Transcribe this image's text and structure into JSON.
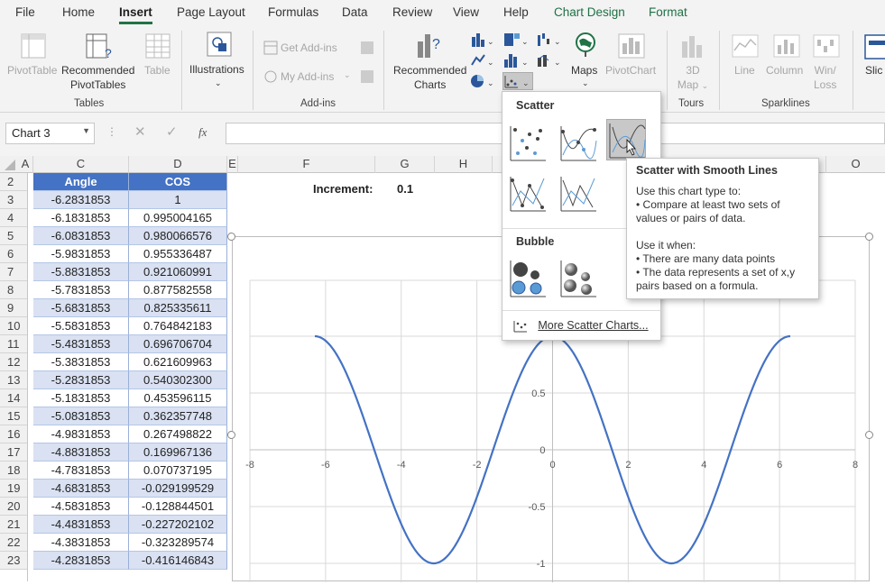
{
  "menu": {
    "tabs": [
      "File",
      "Home",
      "Insert",
      "Page Layout",
      "Formulas",
      "Data",
      "Review",
      "View",
      "Help",
      "Chart Design",
      "Format"
    ]
  },
  "ribbon": {
    "pivot_table": "PivotTable",
    "recommended_pivot_1": "Recommended",
    "recommended_pivot_2": "PivotTables",
    "table": "Table",
    "illustrations": "Illustrations",
    "get_addins": "Get Add-ins",
    "my_addins": "My Add-ins",
    "rec_charts_1": "Recommended",
    "rec_charts_2": "Charts",
    "maps": "Maps",
    "pivot_chart": "PivotChart",
    "map3d_1": "3D",
    "map3d_2": "Map",
    "line": "Line",
    "column": "Column",
    "winloss_1": "Win/",
    "winloss_2": "Loss",
    "slicer": "Slic",
    "groups": {
      "tables": "Tables",
      "addins": "Add-ins",
      "tours": "Tours",
      "sparklines": "Sparklines"
    }
  },
  "formula_bar": {
    "name_box": "Chart 3",
    "fx": "fx",
    "value": ""
  },
  "grid": {
    "columns": [
      "A",
      "C",
      "D",
      "E",
      "F",
      "G",
      "H",
      "O"
    ],
    "increment_label": "Increment:",
    "increment_value": "0.1",
    "headers": [
      "Angle",
      "COS"
    ],
    "rows": [
      {
        "r": "2",
        "angle": "",
        "cos": ""
      },
      {
        "r": "3",
        "angle": "-6.2831853",
        "cos": "1"
      },
      {
        "r": "4",
        "angle": "-6.1831853",
        "cos": "0.995004165"
      },
      {
        "r": "5",
        "angle": "-6.0831853",
        "cos": "0.980066576"
      },
      {
        "r": "6",
        "angle": "-5.9831853",
        "cos": "0.955336487"
      },
      {
        "r": "7",
        "angle": "-5.8831853",
        "cos": "0.921060991"
      },
      {
        "r": "8",
        "angle": "-5.7831853",
        "cos": "0.877582558"
      },
      {
        "r": "9",
        "angle": "-5.6831853",
        "cos": "0.825335611"
      },
      {
        "r": "10",
        "angle": "-5.5831853",
        "cos": "0.764842183"
      },
      {
        "r": "11",
        "angle": "-5.4831853",
        "cos": "0.696706704"
      },
      {
        "r": "12",
        "angle": "-5.3831853",
        "cos": "0.621609963"
      },
      {
        "r": "13",
        "angle": "-5.2831853",
        "cos": "0.540302300"
      },
      {
        "r": "14",
        "angle": "-5.1831853",
        "cos": "0.453596115"
      },
      {
        "r": "15",
        "angle": "-5.0831853",
        "cos": "0.362357748"
      },
      {
        "r": "16",
        "angle": "-4.9831853",
        "cos": "0.267498822"
      },
      {
        "r": "17",
        "angle": "-4.8831853",
        "cos": "0.169967136"
      },
      {
        "r": "18",
        "angle": "-4.7831853",
        "cos": "0.070737195"
      },
      {
        "r": "19",
        "angle": "-4.6831853",
        "cos": "-0.029199529"
      },
      {
        "r": "20",
        "angle": "-4.5831853",
        "cos": "-0.128844501"
      },
      {
        "r": "21",
        "angle": "-4.4831853",
        "cos": "-0.227202102"
      },
      {
        "r": "22",
        "angle": "-4.3831853",
        "cos": "-0.323289574"
      },
      {
        "r": "23",
        "angle": "-4.2831853",
        "cos": "-0.416146843"
      }
    ]
  },
  "dropdown": {
    "scatter": "Scatter",
    "bubble": "Bubble",
    "more": "More Scatter Charts..."
  },
  "tooltip": {
    "title": "Scatter with Smooth Lines",
    "lines": [
      "Use this chart type to:",
      "• Compare at least two sets of",
      "values or pairs of data.",
      "",
      "Use it when:",
      "• There are many data points",
      "• The data represents a set of x,y",
      "pairs based on a formula."
    ]
  },
  "chart_data": {
    "type": "scatter",
    "x_ticks": [
      "-8",
      "-6",
      "-4",
      "-2",
      "0",
      "2",
      "4",
      "6",
      "8"
    ],
    "y_ticks": [
      "0.5",
      "0",
      "-0.5",
      "-1"
    ],
    "xlim": [
      -8,
      8
    ],
    "ylim": [
      -1,
      1
    ],
    "series": [
      {
        "x_start": -6.2831853,
        "x_end": 6.2831853,
        "step": 0.1,
        "function": "cos"
      }
    ],
    "color": "#4472c4"
  }
}
